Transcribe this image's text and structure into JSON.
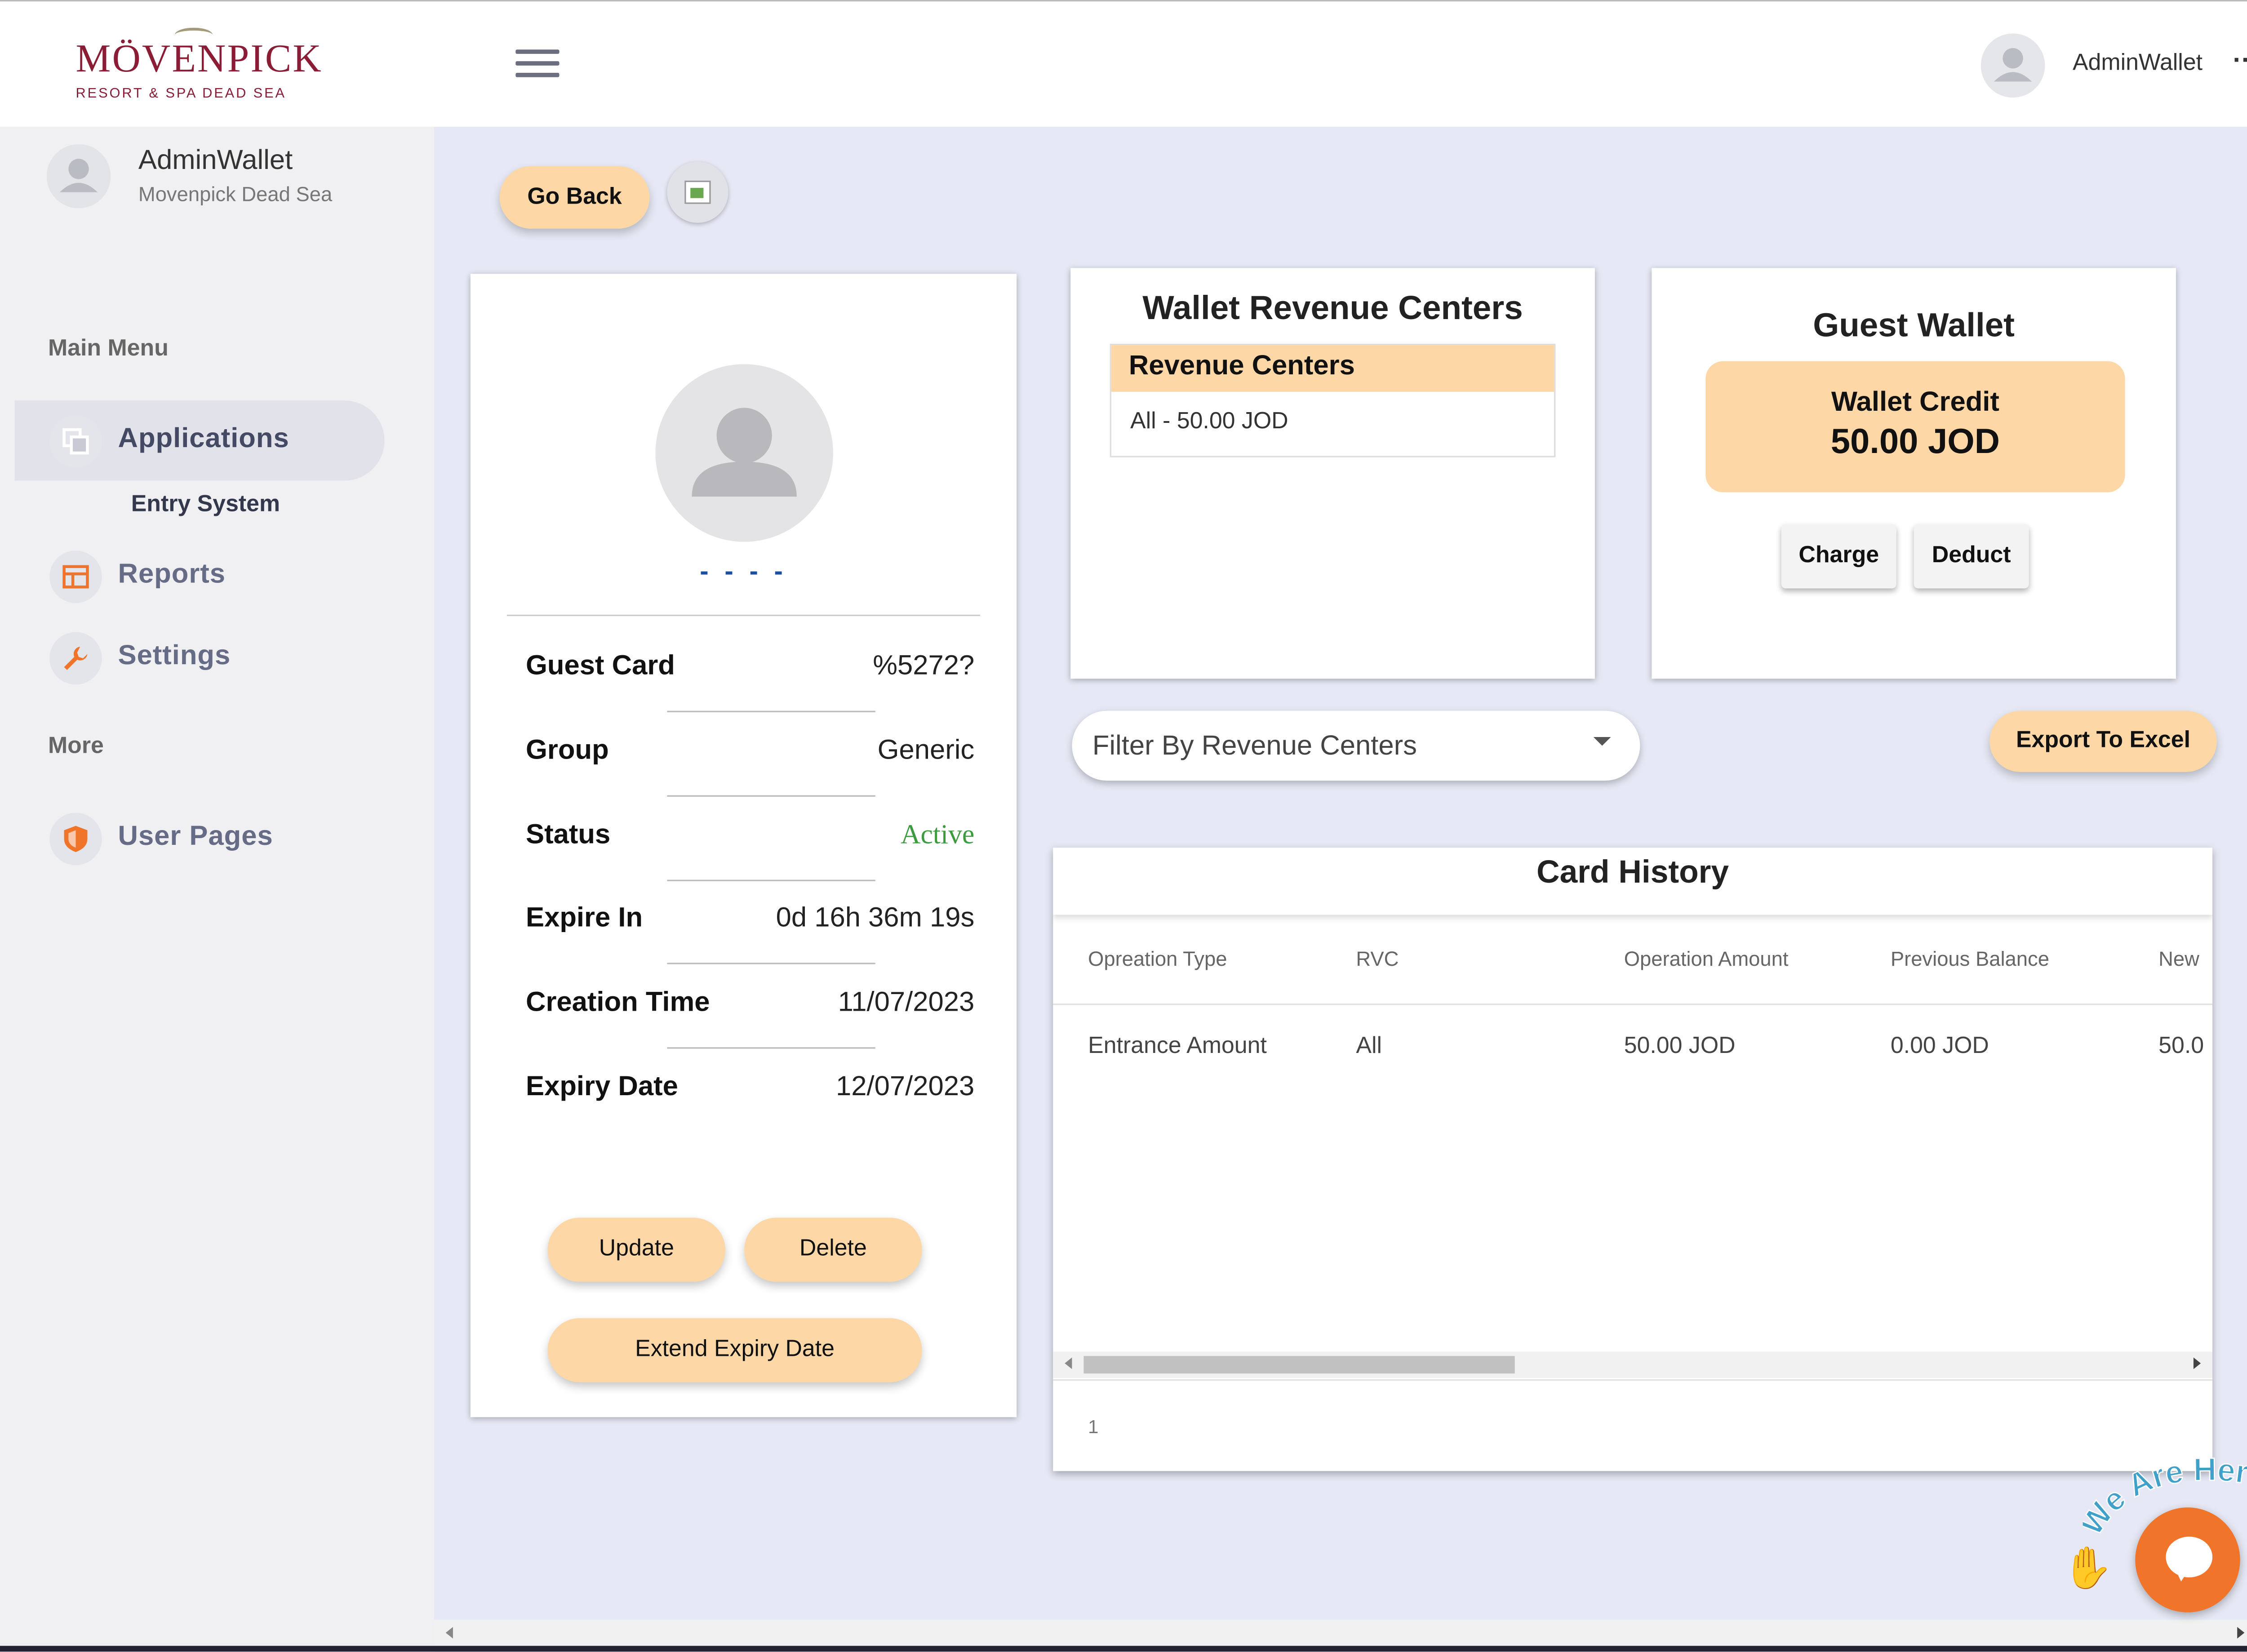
{
  "brand": {
    "name": "MÖVENPICK",
    "tagline": "RESORT & SPA DEAD SEA"
  },
  "topbar": {
    "username": "AdminWallet",
    "more": "···"
  },
  "sidebar": {
    "user_name": "AdminWallet",
    "user_hotel": "Movenpick Dead Sea",
    "main_menu_label": "Main Menu",
    "more_label": "More",
    "items": [
      {
        "label": "Applications",
        "icon": "applications-icon"
      },
      {
        "label": "Reports",
        "icon": "reports-icon"
      },
      {
        "label": "Settings",
        "icon": "wrench-icon"
      },
      {
        "label": "User Pages",
        "icon": "shield-icon"
      }
    ],
    "submenu": "Entry System"
  },
  "actions": {
    "go_back": "Go Back"
  },
  "guest": {
    "name_placeholder": "- - - -",
    "fields": [
      {
        "label": "Guest Card",
        "value": "%5272?"
      },
      {
        "label": "Group",
        "value": "Generic"
      },
      {
        "label": "Status",
        "value": "Active"
      },
      {
        "label": "Expire In",
        "value": "0d 16h 36m 19s"
      },
      {
        "label": "Creation Time",
        "value": "11/07/2023"
      },
      {
        "label": "Expiry Date",
        "value": "12/07/2023"
      }
    ],
    "buttons": {
      "update": "Update",
      "delete": "Delete",
      "extend": "Extend Expiry Date"
    }
  },
  "revenue_centers": {
    "title": "Wallet Revenue Centers",
    "header": "Revenue Centers",
    "rows": [
      "All - 50.00 JOD"
    ]
  },
  "guest_wallet": {
    "title": "Guest Wallet",
    "credit_label": "Wallet Credit",
    "credit_value": "50.00 JOD",
    "charge": "Charge",
    "deduct": "Deduct"
  },
  "filter": {
    "placeholder": "Filter By Revenue Centers"
  },
  "export_label": "Export To Excel",
  "history": {
    "title": "Card History",
    "columns": [
      "Opreation Type",
      "RVC",
      "Operation Amount",
      "Previous Balance",
      "New"
    ],
    "rows": [
      [
        "Entrance Amount",
        "All",
        "50.00 JOD",
        "0.00 JOD",
        "50.0"
      ]
    ],
    "page": "1"
  },
  "chat": {
    "tagline": "We Are Here!"
  },
  "colors": {
    "accent": "#fdd8a6",
    "brand": "#8a1c35",
    "chat": "#f0742a",
    "active_status": "#3c9b3c"
  }
}
